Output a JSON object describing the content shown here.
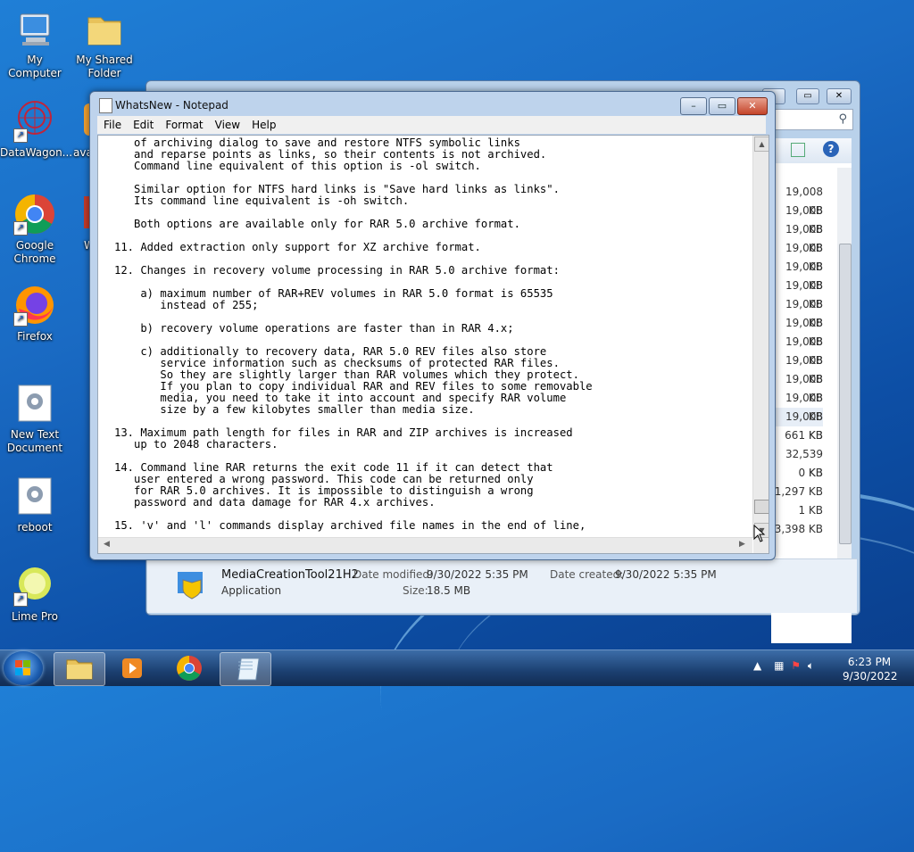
{
  "desktop": {
    "icons": [
      {
        "label": "My Computer"
      },
      {
        "label": "My Shared Folder"
      },
      {
        "label": "DataWagon..."
      },
      {
        "label": "ava"
      },
      {
        "label": "Google Chrome"
      },
      {
        "label": "W"
      },
      {
        "label": "Firefox"
      },
      {
        "label": "New Text Document"
      },
      {
        "label": "reboot"
      },
      {
        "label": "Lime Pro"
      }
    ]
  },
  "explorer": {
    "sizes": [
      "19,008 KB",
      "19,008 KB",
      "19,008 KB",
      "19,008 KB",
      "19,008 KB",
      "19,008 KB",
      "19,008 KB",
      "19,008 KB",
      "19,008 KB",
      "19,008 KB",
      "19,008 KB",
      "19,008 KB",
      "19,008 KB",
      "661 KB",
      "32,539 KB",
      "0 KB",
      "1,297 KB",
      "1 KB",
      "3,398 KB"
    ],
    "details": {
      "name": "MediaCreationTool21H2",
      "type": "Application",
      "date_modified_label": "Date modified:",
      "date_modified": "9/30/2022 5:35 PM",
      "date_created_label": "Date created:",
      "date_created": "9/30/2022 5:35 PM",
      "size_label": "Size:",
      "size": "18.5 MB"
    }
  },
  "notepad": {
    "title": "WhatsNew - Notepad",
    "menu": [
      "File",
      "Edit",
      "Format",
      "View",
      "Help"
    ],
    "content": "   of archiving dialog to save and restore NTFS symbolic links\n   and reparse points as links, so their contents is not archived.\n   Command line equivalent of this option is -ol switch.\n\n   Similar option for NTFS hard links is \"Save hard links as links\".\n   Its command line equivalent is -oh switch.\n\n   Both options are available only for RAR 5.0 archive format.\n\n11. Added extraction only support for XZ archive format.\n\n12. Changes in recovery volume processing in RAR 5.0 archive format:\n\n    a) maximum number of RAR+REV volumes in RAR 5.0 format is 65535\n       instead of 255;\n\n    b) recovery volume operations are faster than in RAR 4.x;\n\n    c) additionally to recovery data, RAR 5.0 REV files also store\n       service information such as checksums of protected RAR files.\n       So they are slightly larger than RAR volumes which they protect.\n       If you plan to copy individual RAR and REV files to some removable\n       media, you need to take it into account and specify RAR volume\n       size by a few kilobytes smaller than media size.\n\n13. Maximum path length for files in RAR and ZIP archives is increased\n   up to 2048 characters.\n\n14. Command line RAR returns the exit code 11 if it can detect that\n   user entered a wrong password. This code can be returned only\n   for RAR 5.0 archives. It is impossible to distinguish a wrong\n   password and data damage for RAR 4.x archives.\n\n15. 'v' and 'l' commands display archived file names in the end of line,"
  },
  "taskbar": {
    "time": "6:23 PM",
    "date": "9/30/2022"
  }
}
